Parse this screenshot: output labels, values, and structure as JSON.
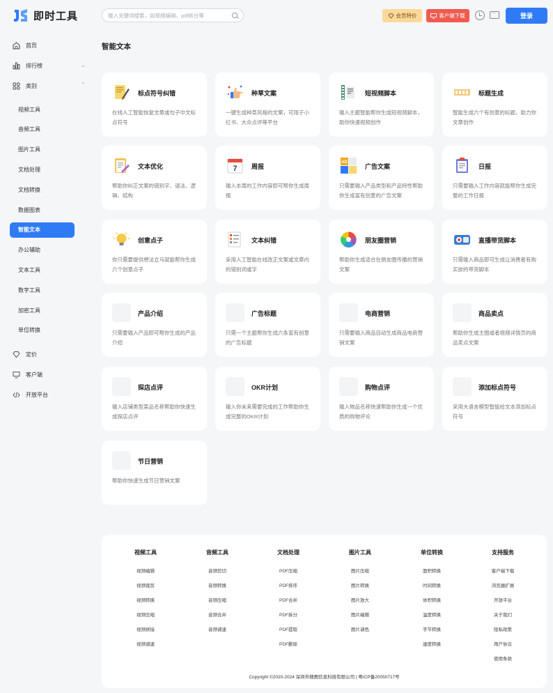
{
  "header": {
    "logo_text": "即时工具",
    "search_placeholder": "输入关键词搜索，如视频编辑，pdf拆分等",
    "vip_label": "会员特价",
    "download_label": "客户端下载",
    "login_label": "登录",
    "accent": "#2f7bf6"
  },
  "sidebar": {
    "top": [
      {
        "label": "首页",
        "icon": "home-icon"
      },
      {
        "label": "排行榜",
        "icon": "bar-chart-icon"
      },
      {
        "label": "类别",
        "icon": "grid-icon"
      }
    ],
    "categories": [
      "视频工具",
      "音频工具",
      "图片工具",
      "文档处理",
      "文档转换",
      "数据图表",
      "智能文本",
      "办公辅助",
      "文本工具",
      "数字工具",
      "加密工具",
      "单位转换"
    ],
    "active": "智能文本",
    "bottom": [
      {
        "label": "定价",
        "icon": "diamond-icon"
      },
      {
        "label": "客户端",
        "icon": "monitor-icon"
      },
      {
        "label": "开放平台",
        "icon": "code-icon"
      }
    ]
  },
  "main": {
    "title": "智能文本",
    "cards": [
      {
        "title": "标点符号纠错",
        "desc": "在线人工智能恢复文章或句子中文标点符号",
        "icon": "notebook-pen-icon"
      },
      {
        "title": "种草文案",
        "desc": "一键生成种草风格的文案，可用于小红书、大众点评等平台",
        "icon": "thumbs-up-icon"
      },
      {
        "title": "短视频脚本",
        "desc": "输入主题智能帮你生成短视频脚本，助你快速视频创作",
        "icon": "film-script-icon"
      },
      {
        "title": "标题生成",
        "desc": "智能生成六个有创意的标题，助力你文章创作",
        "icon": "title-icon"
      },
      {
        "title": "文本优化",
        "desc": "帮助你纠正文案的错别字、语法、逻辑、结构",
        "icon": "document-edit-icon"
      },
      {
        "title": "周报",
        "desc": "输入本周的工作内容即可帮你生成周报",
        "icon": "calendar-7-icon"
      },
      {
        "title": "广告文案",
        "desc": "只需要输入产品类型和产品特性帮助你生成富有创意的广告文案",
        "icon": "ad-icon"
      },
      {
        "title": "日报",
        "desc": "只需要输入工作内容就能帮你生成完整的工作日报",
        "icon": "clipboard-icon"
      },
      {
        "title": "创意点子",
        "desc": "你只需要提供想法立马就能帮你生成六个创意点子",
        "icon": "lightbulb-icon"
      },
      {
        "title": "文本纠错",
        "desc": "采用人工智能在线改正文案或文章内的错别词或字",
        "icon": "checklist-icon"
      },
      {
        "title": "朋友圈营销",
        "desc": "帮助你生成适合在朋友圈传播的营销文案",
        "icon": "color-wheel-icon"
      },
      {
        "title": "直播带货脚本",
        "desc": "只需输入商品即可生成让消费者有购买欲的带货脚本",
        "icon": "live-camera-icon"
      },
      {
        "title": "产品介绍",
        "desc": "只需要输入产品即可帮你生成的产品介绍",
        "icon": "blank-icon"
      },
      {
        "title": "广告标题",
        "desc": "只需一个主题帮你生成六条富有创意的广告标题",
        "icon": "blank-icon"
      },
      {
        "title": "电商营销",
        "desc": "只需要输入商品自动生成商品电商营销文案",
        "icon": "blank-icon"
      },
      {
        "title": "商品卖点",
        "desc": "帮助你生成主图或者视频详情页的商品卖点文案",
        "icon": "blank-icon"
      },
      {
        "title": "探店点评",
        "desc": "输入店铺类型菜品名称帮助你快速生成探店点评",
        "icon": "blank-icon"
      },
      {
        "title": "OKR计划",
        "desc": "输入你未来需要完成的工作帮助你生成完整的OKR计划",
        "icon": "blank-icon"
      },
      {
        "title": "购物点评",
        "desc": "输入物品名称快速帮助你生成一个优质的购物评论",
        "icon": "blank-icon"
      },
      {
        "title": "添加标点符号",
        "desc": "采用大语言模型智能给文本添加标点符号",
        "icon": "blank-icon"
      },
      {
        "title": "节日营销",
        "desc": "帮助你快速生成节日营销文案",
        "icon": "blank-icon"
      }
    ]
  },
  "footer": {
    "columns": [
      {
        "title": "视频工具",
        "links": [
          "视频编辑",
          "视频裁剪",
          "视频转换",
          "视频压缩",
          "视频拼接",
          "视频调速"
        ]
      },
      {
        "title": "音频工具",
        "links": [
          "音频剪切",
          "音频转换",
          "音频压缩",
          "音频合并",
          "音频调速"
        ]
      },
      {
        "title": "文档处理",
        "links": [
          "PDF压缩",
          "PDF排序",
          "PDF合并",
          "PDF拆分",
          "PDF提取",
          "PDF删除"
        ]
      },
      {
        "title": "图片工具",
        "links": [
          "图片压缩",
          "图片转换",
          "图片放大",
          "图片编辑",
          "图片调色"
        ]
      },
      {
        "title": "单位转换",
        "links": [
          "面积转换",
          "时间转换",
          "体积转换",
          "温度转换",
          "字节转换",
          "速度转换"
        ]
      },
      {
        "title": "支持服务",
        "links": [
          "客户端下载",
          "浏览器扩展",
          "开放平台",
          "关于我们",
          "隐私政策",
          "用户协议",
          "使用条款"
        ]
      }
    ],
    "copyright": "Copyright ©2020-2024 深圳市搜图信息科技有限公司 | 粤ICP备20050717号"
  }
}
